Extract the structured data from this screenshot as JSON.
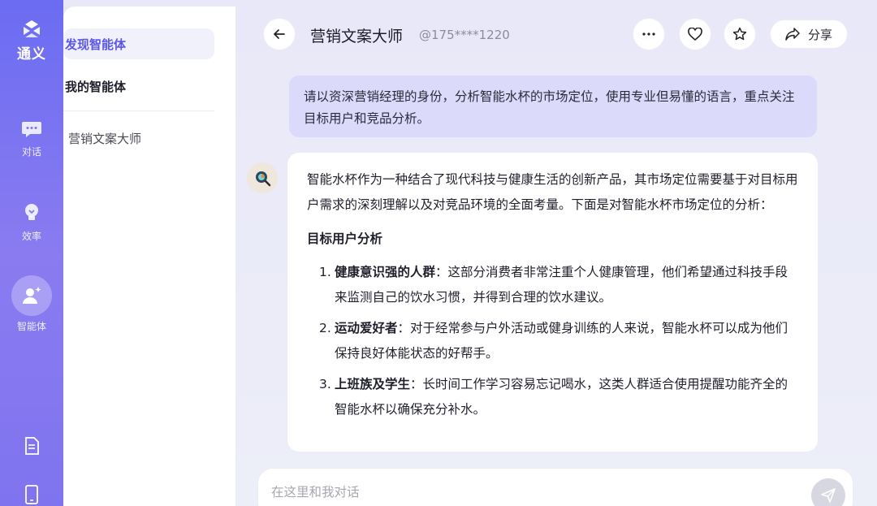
{
  "rail": {
    "logo_text": "通义",
    "items": [
      {
        "label": "对话",
        "icon": "chat-icon"
      },
      {
        "label": "效率",
        "icon": "lightbulb-icon"
      },
      {
        "label": "智能体",
        "icon": "agent-icon"
      }
    ],
    "bottom_icons": [
      "document-icon",
      "phone-icon"
    ],
    "accent": "#6b6cf2"
  },
  "sidebar": {
    "discover": "发现智能体",
    "mine": "我的智能体",
    "agents": [
      "营销文案大师"
    ]
  },
  "header": {
    "title": "营销文案大师",
    "account": "@175****1220",
    "share_label": "分享"
  },
  "conversation": {
    "user_message": "请以资深营销经理的身份，分析智能水杯的市场定位，使用专业但易懂的语言，重点关注目标用户和竞品分析。",
    "bot": {
      "intro": "智能水杯作为一种结合了现代科技与健康生活的创新产品，其市场定位需要基于对目标用户需求的深刻理解以及对竞品环境的全面考量。下面是对智能水杯市场定位的分析：",
      "section_title": "目标用户分析",
      "items": [
        {
          "num": "1.",
          "title": "健康意识强的人群",
          "text": "：这部分消费者非常注重个人健康管理，他们希望通过科技手段来监测自己的饮水习惯，并得到合理的饮水建议。"
        },
        {
          "num": "2.",
          "title": "运动爱好者",
          "text": "：对于经常参与户外活动或健身训练的人来说，智能水杯可以成为他们保持良好体能状态的好帮手。"
        },
        {
          "num": "3.",
          "title": "上班族及学生",
          "text": "：长时间工作学习容易忘记喝水，这类人群适合使用提醒功能齐全的智能水杯以确保充分补水。"
        }
      ]
    }
  },
  "composer": {
    "placeholder": "在这里和我对话"
  }
}
